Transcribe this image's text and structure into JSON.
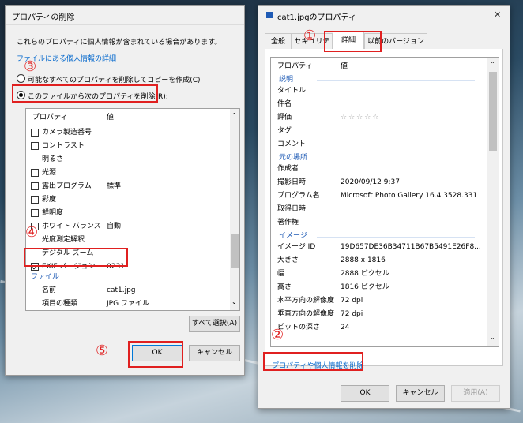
{
  "left_dialog": {
    "title": "プロパティの削除",
    "info_text": "これらのプロパティに個人情報が含まれている場合があります。",
    "info_link": "ファイルにある個人情報の詳細",
    "radio1_label": "可能なすべてのプロパティを削除してコピーを作成(C)",
    "radio2_label": "このファイルから次のプロパティを削除(R):",
    "col_property": "プロパティ",
    "col_value": "値",
    "rows": [
      {
        "label": "カメラ製造番号",
        "value": "",
        "checkbox": true,
        "checked": false
      },
      {
        "label": "コントラスト",
        "value": "",
        "checkbox": true,
        "checked": false
      },
      {
        "label": "明るさ",
        "value": "",
        "checkbox": false,
        "checked": false
      },
      {
        "label": "光源",
        "value": "",
        "checkbox": true,
        "checked": false
      },
      {
        "label": "露出プログラム",
        "value": "標準",
        "checkbox": true,
        "checked": false
      },
      {
        "label": "彩度",
        "value": "",
        "checkbox": true,
        "checked": false
      },
      {
        "label": "鮮明度",
        "value": "",
        "checkbox": true,
        "checked": false
      },
      {
        "label": "ホワイト バランス",
        "value": "自動",
        "checkbox": true,
        "checked": false
      },
      {
        "label": "光度測定解釈",
        "value": "",
        "checkbox": false,
        "checked": false
      },
      {
        "label": "デジタル ズーム",
        "value": "",
        "checkbox": false,
        "checked": false
      },
      {
        "label": "EXIF バージョン",
        "value": "0231",
        "checkbox": true,
        "checked": true
      }
    ],
    "group_file": "ファイル",
    "file_rows": [
      {
        "label": "名前",
        "value": "cat1.jpg"
      },
      {
        "label": "項目の種類",
        "value": "JPG ファイル"
      }
    ],
    "select_all": "すべて選択(A)",
    "ok": "OK",
    "cancel": "キャンセル"
  },
  "right_dialog": {
    "title": "cat1.jpgのプロパティ",
    "close_glyph": "✕",
    "tabs": [
      "全般",
      "セキュリティ",
      "詳細",
      "以前のバージョン"
    ],
    "col_property": "プロパティ",
    "col_value": "値",
    "group_description": "説明",
    "desc_rows": [
      {
        "label": "タイトル",
        "value": ""
      },
      {
        "label": "件名",
        "value": ""
      },
      {
        "label": "評価",
        "value": "☆☆☆☆☆"
      },
      {
        "label": "タグ",
        "value": ""
      },
      {
        "label": "コメント",
        "value": ""
      }
    ],
    "group_origin": "元の場所",
    "origin_rows": [
      {
        "label": "作成者",
        "value": ""
      },
      {
        "label": "撮影日時",
        "value": "2020/09/12 9:37"
      },
      {
        "label": "プログラム名",
        "value": "Microsoft Photo Gallery 16.4.3528.331"
      },
      {
        "label": "取得日時",
        "value": ""
      },
      {
        "label": "著作権",
        "value": ""
      }
    ],
    "group_image": "イメージ",
    "image_rows": [
      {
        "label": "イメージ ID",
        "value": "19D657DE36B34711B67B5491E26F8..."
      },
      {
        "label": "大きさ",
        "value": "2888 x 1816"
      },
      {
        "label": "幅",
        "value": "2888 ピクセル"
      },
      {
        "label": "高さ",
        "value": "1816 ピクセル"
      },
      {
        "label": "水平方向の解像度",
        "value": "72 dpi"
      },
      {
        "label": "垂直方向の解像度",
        "value": "72 dpi"
      },
      {
        "label": "ビットの深さ",
        "value": "24"
      }
    ],
    "remove_link": "プロパティや個人情報を削除",
    "ok": "OK",
    "cancel": "キャンセル",
    "apply": "適用(A)"
  },
  "annotations": [
    "①",
    "②",
    "③",
    "④",
    "⑤"
  ],
  "colors": {
    "highlight": "#e02020",
    "link": "#0066cc",
    "group": "#1f5bb5"
  }
}
